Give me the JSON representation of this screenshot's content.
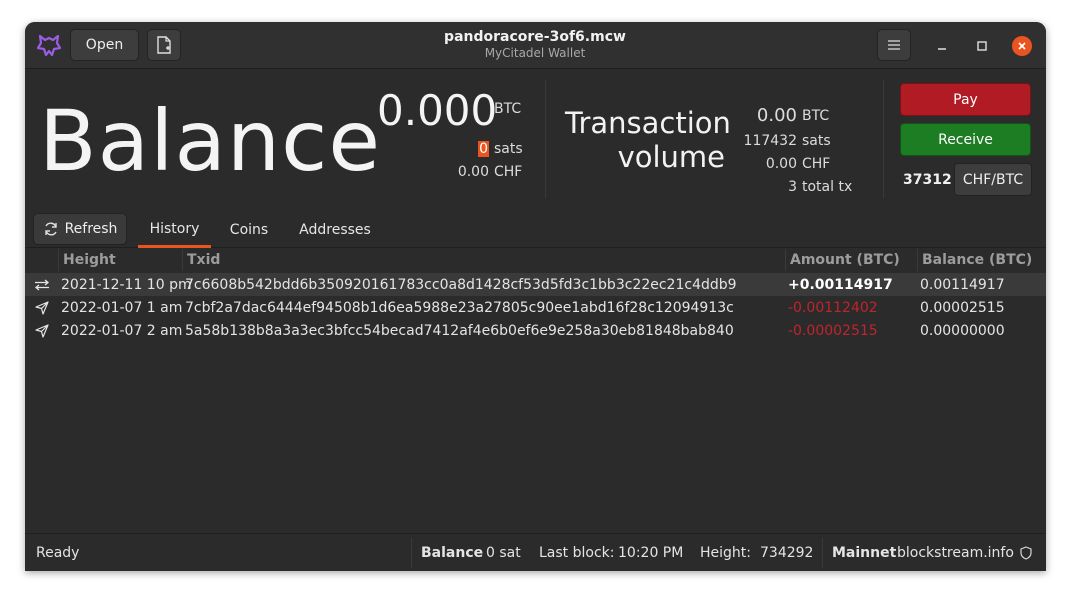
{
  "window": {
    "title": "pandoracore-3of6.mcw",
    "subtitle": "MyCitadel Wallet"
  },
  "header": {
    "open_label": "Open",
    "menu_icon": "hamburger-menu-icon"
  },
  "balance": {
    "heading": "Balance",
    "btc_value": "0.000",
    "btc_unit": "BTC",
    "sats_value": "0",
    "sats_unit": "sats",
    "fiat_value": "0.00",
    "fiat_unit": "CHF"
  },
  "volume": {
    "label_line1": "Transaction",
    "label_line2": "volume",
    "btc_value": "0.00",
    "btc_unit": "BTC",
    "sats_value": "117432",
    "sats_unit": "sats",
    "fiat_value": "0.00",
    "fiat_unit": "CHF",
    "tx_count": "3",
    "tx_unit": "total tx"
  },
  "actions": {
    "pay_label": "Pay",
    "receive_label": "Receive",
    "rate_value": "37312",
    "rate_pair_label": "CHF/BTC"
  },
  "tabs": {
    "refresh_label": "Refresh",
    "items": [
      "History",
      "Coins",
      "Addresses"
    ],
    "active": "History"
  },
  "table": {
    "headers": [
      "Height",
      "Txid",
      "Amount (BTC)",
      "Balance (BTC)"
    ],
    "rows": [
      {
        "direction": "transfer",
        "height": "2021-12-11 10 pm",
        "txid": "7c6608b542bdd6b350920161783cc0a8d1428cf53d5fd3c1bb3c22ec21c4ddb9",
        "amount": "+0.00114917",
        "balance": "0.00114917"
      },
      {
        "direction": "sent",
        "height": "2022-01-07  1 am",
        "txid": "7cbf2a7dac6444ef94508b1d6ea5988e23a27805c90ee1abd16f28c12094913c",
        "amount": "-0.00112402",
        "balance": "0.00002515"
      },
      {
        "direction": "sent",
        "height": "2022-01-07  2 am",
        "txid": "5a58b138b8a3a3ec3bfcc54becad7412af4e6b0ef6e9e258a30eb81848bab840",
        "amount": "-0.00002515",
        "balance": "0.00000000"
      }
    ]
  },
  "status": {
    "state": "Ready",
    "balance_label": "Balance",
    "balance_value": "0 sat",
    "last_block_label": "Last block:",
    "last_block_value": "10:20 PM",
    "height_label": "Height:",
    "height_value": "734292",
    "network": "Mainnet",
    "server": "blockstream.info"
  },
  "colors": {
    "accent": "#e95420",
    "pay": "#b01b24",
    "receive": "#1d7d22",
    "negative": "#c0242d"
  }
}
